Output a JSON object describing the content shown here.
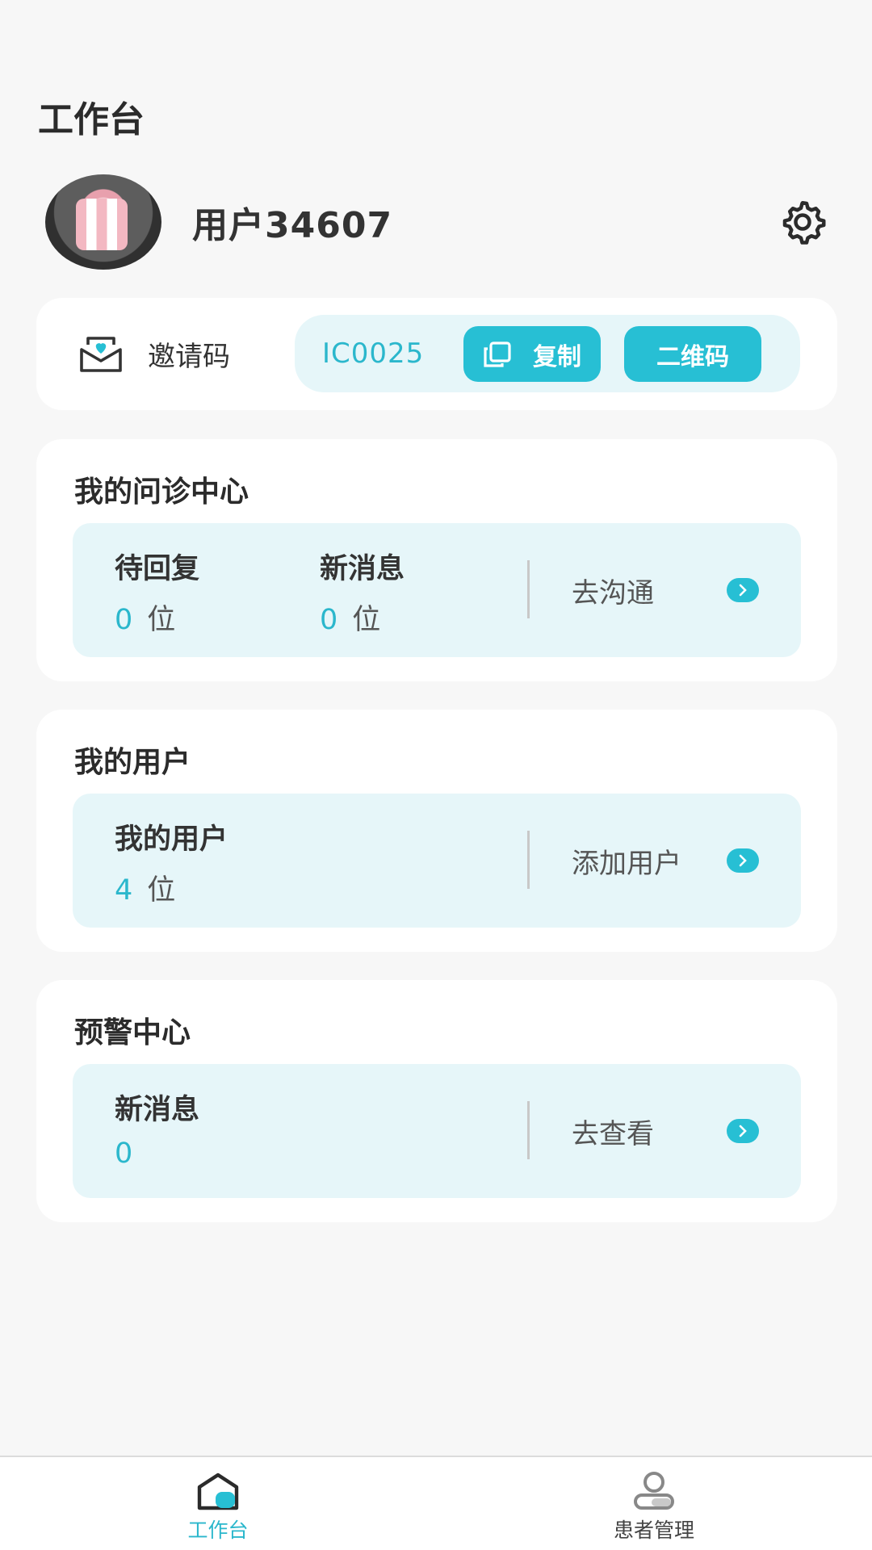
{
  "header": {
    "title": "工作台"
  },
  "profile": {
    "username": "用户34607",
    "avatar_icon": "avatar-photo",
    "settings_icon": "gear-icon"
  },
  "invite": {
    "label": "邀请码",
    "code": "IC0025",
    "copy_label": "复制",
    "qr_label": "二维码"
  },
  "consult": {
    "title": "我的问诊中心",
    "pending_label": "待回复",
    "pending_value": "0",
    "pending_unit": "位",
    "new_label": "新消息",
    "new_value": "0",
    "new_unit": "位",
    "action_label": "去沟通"
  },
  "users": {
    "title": "我的用户",
    "count_label": "我的用户",
    "count_value": "4",
    "count_unit": "位",
    "action_label": "添加用户"
  },
  "alerts": {
    "title": "预警中心",
    "new_label": "新消息",
    "new_value": "0",
    "action_label": "去查看"
  },
  "tabs": [
    {
      "label": "工作台",
      "active": true
    },
    {
      "label": "患者管理",
      "active": false
    }
  ],
  "colors": {
    "accent": "#27bfd4",
    "light_bg": "#e6f6f9",
    "page_bg": "#f7f7f7"
  }
}
